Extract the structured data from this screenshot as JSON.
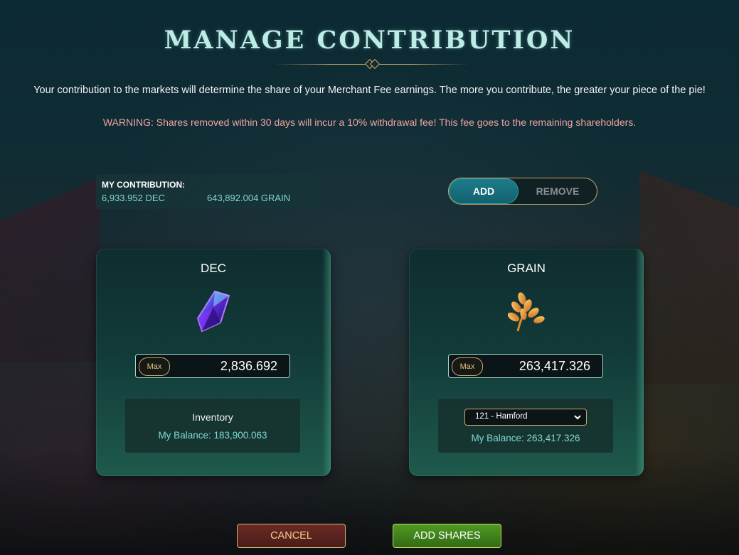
{
  "header": {
    "title": "MANAGE CONTRIBUTION",
    "intro": "Your contribution to the markets will determine the share of your Merchant Fee earnings. The more you contribute, the greater your piece of the pie!",
    "warning": "WARNING: Shares removed within 30 days will incur a 10% withdrawal fee! This fee goes to the remaining shareholders."
  },
  "my_contribution": {
    "label": "MY CONTRIBUTION:",
    "dec": "6,933.952 DEC",
    "grain": "643,892.004 GRAIN"
  },
  "mode_toggle": {
    "add_label": "ADD",
    "remove_label": "REMOVE",
    "selected": "ADD"
  },
  "dec_card": {
    "title": "DEC",
    "icon": "dec-crystal-icon",
    "max_label": "Max",
    "amount": "2,836.692",
    "inventory_label": "Inventory",
    "balance": "My Balance: 183,900.063"
  },
  "grain_card": {
    "title": "GRAIN",
    "icon": "grain-wheat-icon",
    "max_label": "Max",
    "amount": "263,417.326",
    "land_select": "121 - Hamford",
    "balance": "My Balance: 263,417.326"
  },
  "actions": {
    "cancel_label": "CANCEL",
    "add_shares_label": "ADD SHARES"
  },
  "colors": {
    "title": "#bdebe6",
    "accent_teal": "#7fd6d6",
    "warning": "#f0a4a4",
    "gold_border": "#c9a86a",
    "cancel_bg": "#5a231f",
    "add_shares_bg": "#438a1d"
  }
}
